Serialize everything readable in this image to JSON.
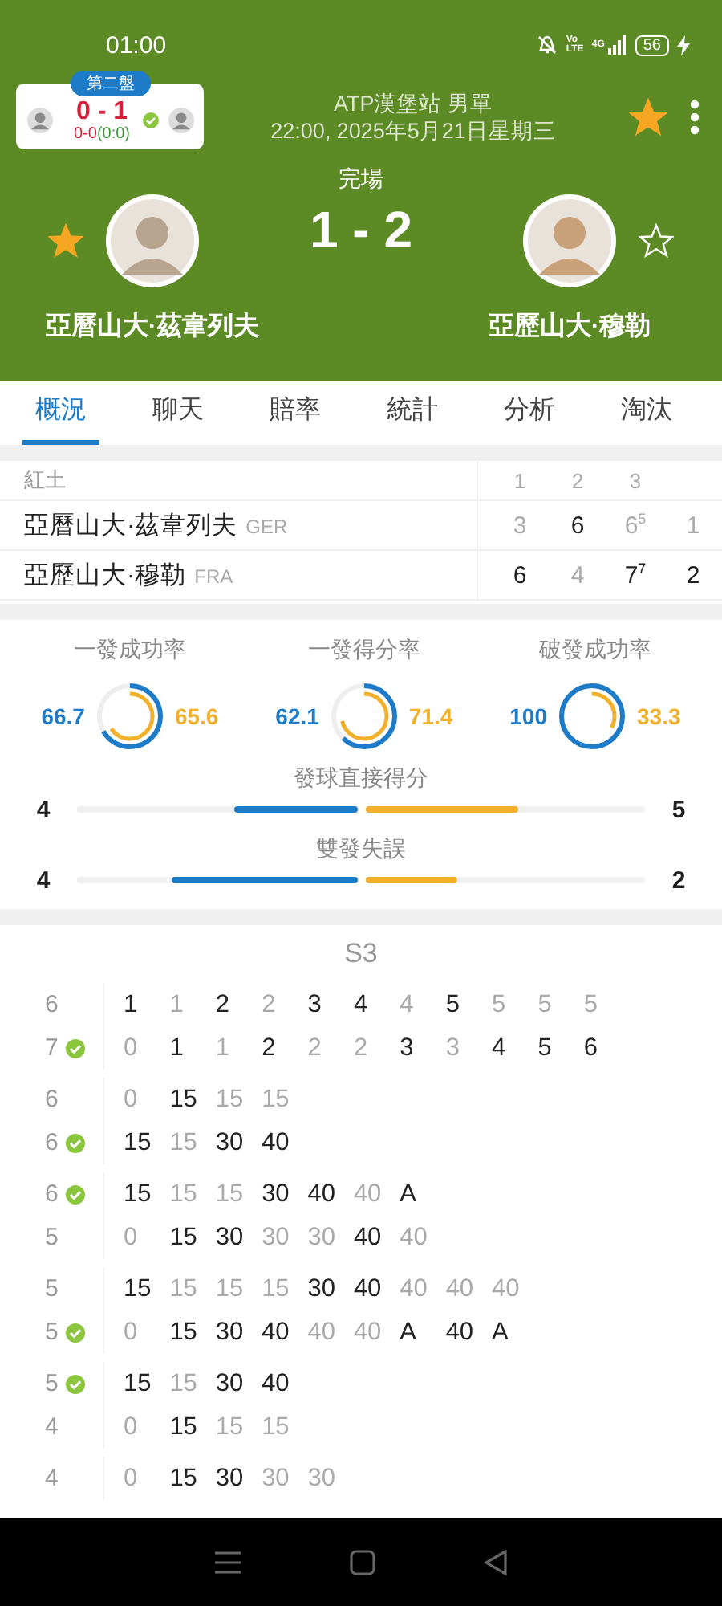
{
  "status_bar": {
    "time": "01:00",
    "volte": "Vo LTE",
    "network": "4G",
    "battery": "56",
    "charging": true
  },
  "mini_score": {
    "badge": "第二盤",
    "score": "0 - 1",
    "games": "0-0",
    "tiebreak": "(0:0)"
  },
  "match": {
    "tournament": "ATP漢堡站 男單",
    "datetime": "22:00, 2025年5月21日星期三",
    "favorite": true,
    "status": "完場",
    "score": "1 - 2",
    "home": {
      "name": "亞曆山大·茲韋列夫",
      "followed": true
    },
    "away": {
      "name": "亞歷山大·穆勒",
      "followed": false
    }
  },
  "tabs": [
    {
      "label": "概況",
      "selected": true
    },
    {
      "label": "聊天",
      "selected": false
    },
    {
      "label": "賠率",
      "selected": false
    },
    {
      "label": "統計",
      "selected": false
    },
    {
      "label": "分析",
      "selected": false
    },
    {
      "label": "淘汰",
      "selected": false
    }
  ],
  "sets_table": {
    "surface": "紅土",
    "columns": [
      "1",
      "2",
      "3"
    ],
    "rows": [
      {
        "name": "亞曆山大·茲韋列夫",
        "country": "GER",
        "scores": [
          {
            "value": "3",
            "won": false
          },
          {
            "value": "6",
            "won": true
          },
          {
            "value": "6",
            "won": false,
            "tiebreak": "5"
          },
          {
            "value": "1",
            "won": false
          }
        ]
      },
      {
        "name": "亞歷山大·穆勒",
        "country": "FRA",
        "scores": [
          {
            "value": "6",
            "won": true
          },
          {
            "value": "4",
            "won": false
          },
          {
            "value": "7",
            "won": true,
            "tiebreak": "7"
          },
          {
            "value": "2",
            "won": true
          }
        ]
      }
    ]
  },
  "rate_stats": [
    {
      "label": "一發成功率",
      "home": {
        "value": "66.7",
        "level": 0.667
      },
      "away": {
        "value": "65.6",
        "level": 0.656
      }
    },
    {
      "label": "一發得分率",
      "home": {
        "value": "62.1",
        "level": 0.621
      },
      "away": {
        "value": "71.4",
        "level": 0.714
      }
    },
    {
      "label": "破發成功率",
      "home": {
        "value": "100",
        "level": 1
      },
      "away": {
        "value": "33.3",
        "level": 0.333
      }
    }
  ],
  "count_stats": [
    {
      "label": "發球直接得分",
      "home": {
        "value": "4",
        "level": 0.44
      },
      "away": {
        "value": "5",
        "level": 0.55
      }
    },
    {
      "label": "雙發失誤",
      "home": {
        "value": "4",
        "level": 0.66
      },
      "away": {
        "value": "2",
        "level": 0.33
      }
    }
  ],
  "point_by_point": {
    "title": "S3",
    "games": [
      {
        "home": {
          "games": "6",
          "checked": false
        },
        "away": {
          "games": "7",
          "checked": true
        },
        "points": [
          {
            "home": "1",
            "away": "0",
            "home_won": true
          },
          {
            "home": "1",
            "away": "1",
            "home_won": false
          },
          {
            "home": "2",
            "away": "1",
            "home_won": true
          },
          {
            "home": "2",
            "away": "2",
            "home_won": false
          },
          {
            "home": "3",
            "away": "2",
            "home_won": true
          },
          {
            "home": "4",
            "away": "2",
            "home_won": true
          },
          {
            "home": "4",
            "away": "3",
            "home_won": false
          },
          {
            "home": "5",
            "away": "3",
            "home_won": true
          },
          {
            "home": "5",
            "away": "4",
            "home_won": false
          },
          {
            "home": "5",
            "away": "5",
            "home_won": false
          },
          {
            "home": "5",
            "away": "6",
            "home_won": false
          }
        ]
      },
      {
        "home": {
          "games": "6",
          "checked": false
        },
        "away": {
          "games": "6",
          "checked": true
        },
        "points": [
          {
            "home": "0",
            "away": "15",
            "home_won": false
          },
          {
            "home": "15",
            "away": "15",
            "home_won": true
          },
          {
            "home": "15",
            "away": "30",
            "home_won": false
          },
          {
            "home": "15",
            "away": "40",
            "home_won": false
          }
        ]
      },
      {
        "home": {
          "games": "6",
          "checked": true
        },
        "away": {
          "games": "5",
          "checked": false
        },
        "points": [
          {
            "home": "15",
            "away": "0",
            "home_won": true
          },
          {
            "home": "15",
            "away": "15",
            "home_won": false
          },
          {
            "home": "15",
            "away": "30",
            "home_won": false
          },
          {
            "home": "30",
            "away": "30",
            "home_won": true
          },
          {
            "home": "40",
            "away": "30",
            "home_won": true
          },
          {
            "home": "40",
            "away": "40",
            "home_won": false
          },
          {
            "home": "A",
            "away": "40",
            "home_won": true
          }
        ]
      },
      {
        "home": {
          "games": "5",
          "checked": false
        },
        "away": {
          "games": "5",
          "checked": true
        },
        "points": [
          {
            "home": "15",
            "away": "0",
            "home_won": true
          },
          {
            "home": "15",
            "away": "15",
            "home_won": false
          },
          {
            "home": "15",
            "away": "30",
            "home_won": false
          },
          {
            "home": "15",
            "away": "40",
            "home_won": false
          },
          {
            "home": "30",
            "away": "40",
            "home_won": true
          },
          {
            "home": "40",
            "away": "40",
            "home_won": true
          },
          {
            "home": "40",
            "away": "A",
            "home_won": false
          },
          {
            "home": "40",
            "away": "40",
            "home_won": false
          },
          {
            "home": "40",
            "away": "A",
            "home_won": false
          }
        ]
      },
      {
        "home": {
          "games": "5",
          "checked": true
        },
        "away": {
          "games": "4",
          "checked": false
        },
        "points": [
          {
            "home": "15",
            "away": "0",
            "home_won": true
          },
          {
            "home": "15",
            "away": "15",
            "home_won": false
          },
          {
            "home": "30",
            "away": "15",
            "home_won": true
          },
          {
            "home": "40",
            "away": "15",
            "home_won": true
          }
        ]
      },
      {
        "home": {
          "games": "4",
          "checked": false
        },
        "points": [
          {
            "home": "0",
            "home_won": false
          },
          {
            "home": "15",
            "home_won": true
          },
          {
            "home": "30",
            "home_won": true
          },
          {
            "home": "30",
            "home_won": false
          },
          {
            "home": "30",
            "home_won": false
          }
        ]
      }
    ]
  }
}
